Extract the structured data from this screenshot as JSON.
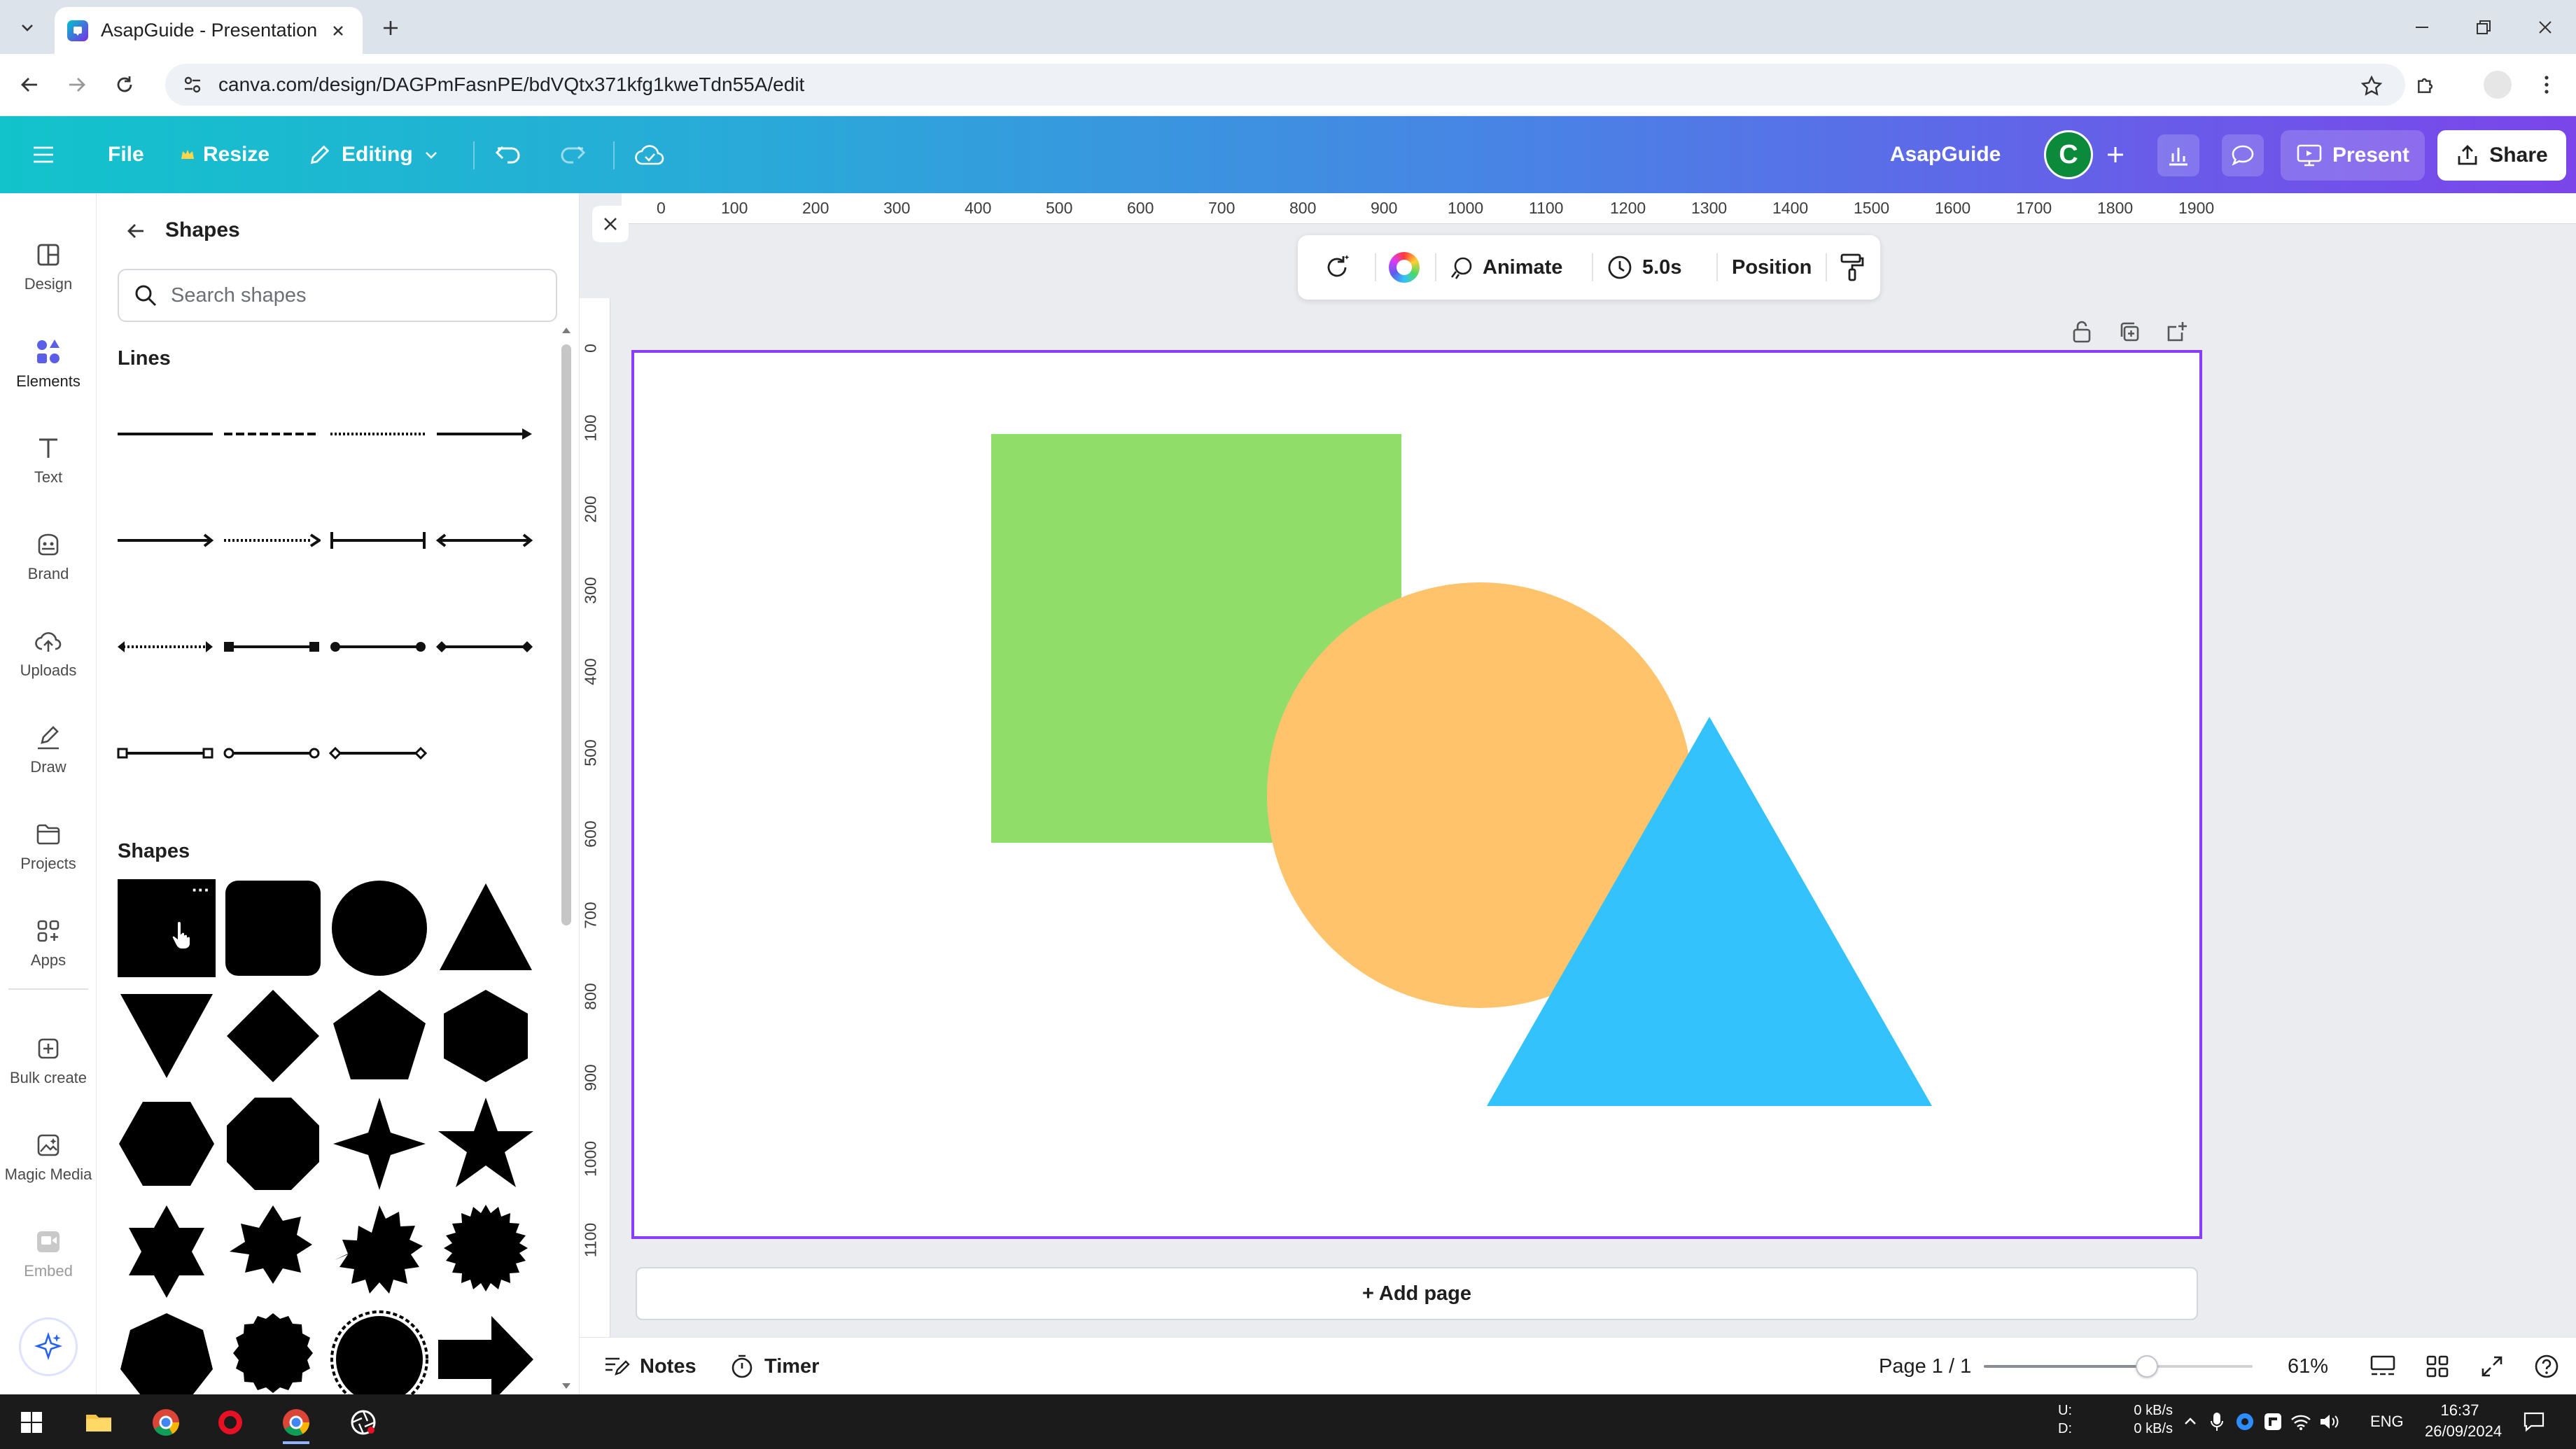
{
  "browser": {
    "tab_title": "AsapGuide - Presentation",
    "url": "canva.com/design/DAGPmFasnPE/bdVQtx371kfg1kweTdn55A/edit"
  },
  "header": {
    "file_label": "File",
    "resize_label": "Resize",
    "editing_label": "Editing",
    "team_name": "AsapGuide",
    "avatar_letter": "C",
    "present_label": "Present",
    "share_label": "Share"
  },
  "rail": {
    "items": [
      {
        "label": "Design"
      },
      {
        "label": "Elements"
      },
      {
        "label": "Text"
      },
      {
        "label": "Brand"
      },
      {
        "label": "Uploads"
      },
      {
        "label": "Draw"
      },
      {
        "label": "Projects"
      },
      {
        "label": "Apps"
      },
      {
        "label": "Bulk create"
      },
      {
        "label": "Magic Media"
      },
      {
        "label": "Embed"
      }
    ],
    "active": "Elements"
  },
  "panel": {
    "title": "Shapes",
    "search_placeholder": "Search shapes",
    "lines_heading": "Lines",
    "shapes_heading": "Shapes",
    "shape_more": "···"
  },
  "toolbar": {
    "animate_label": "Animate",
    "duration_label": "5.0s",
    "position_label": "Position"
  },
  "ruler": {
    "top": [
      "0",
      "100",
      "200",
      "300",
      "400",
      "500",
      "600",
      "700",
      "800",
      "900",
      "1000",
      "1100",
      "1200",
      "1300",
      "1400",
      "1500",
      "1600",
      "1700",
      "1800",
      "1900"
    ],
    "left": [
      "0",
      "100",
      "200",
      "300",
      "400",
      "500",
      "600",
      "700",
      "800",
      "900",
      "1000",
      "1100"
    ]
  },
  "canvas": {
    "add_page_label": "+ Add page",
    "shapes": [
      {
        "kind": "square",
        "color": "#91dd69"
      },
      {
        "kind": "circle",
        "color": "#fec36b"
      },
      {
        "kind": "triangle",
        "color": "#33c2fb"
      }
    ]
  },
  "footer": {
    "notes_label": "Notes",
    "timer_label": "Timer",
    "page_indicator": "Page 1 / 1",
    "zoom_label": "61%",
    "zoom_fraction": 0.61
  },
  "taskbar": {
    "net_labels": "U:\nD:",
    "net_speed": "0 kB/s\n0 kB/s",
    "language": "ENG",
    "time": "16:37",
    "date": "26/09/2024"
  },
  "colors": {
    "accent": "#8b3dff",
    "header_start": "#12c3cb",
    "header_end": "#7b45ea"
  }
}
